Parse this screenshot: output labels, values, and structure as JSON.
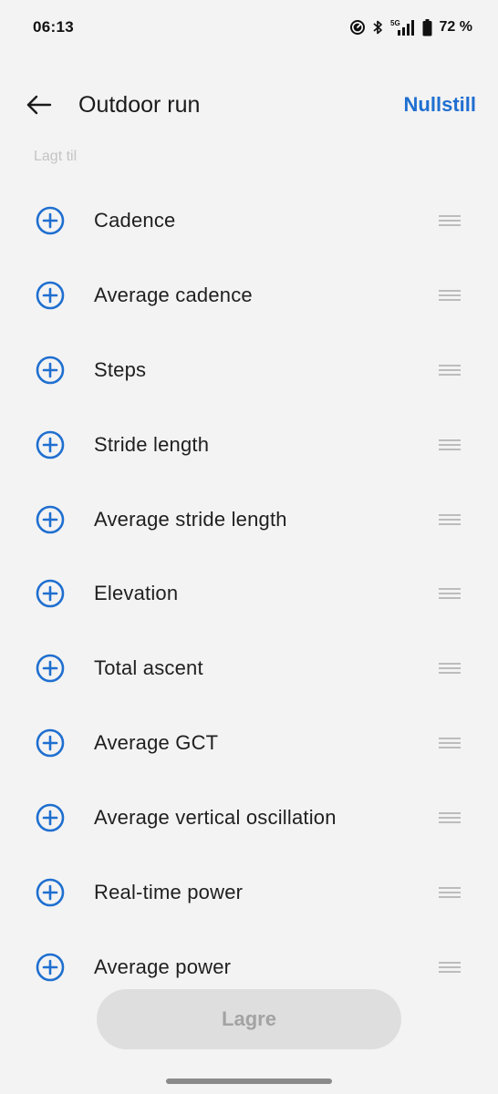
{
  "status_bar": {
    "time": "06:13",
    "network": "5G",
    "battery_text": "72 %",
    "icons": [
      "speedometer-icon",
      "bluetooth-icon",
      "signal-icon",
      "battery-icon"
    ]
  },
  "header": {
    "title": "Outdoor run",
    "back_icon": "arrow-left-icon",
    "reset_label": "Nullstill"
  },
  "section": {
    "label": "Lagt til"
  },
  "metrics": [
    {
      "label": "Cadence"
    },
    {
      "label": "Average cadence"
    },
    {
      "label": "Steps"
    },
    {
      "label": "Stride length"
    },
    {
      "label": "Average stride length"
    },
    {
      "label": "Elevation"
    },
    {
      "label": "Total ascent"
    },
    {
      "label": "Average GCT"
    },
    {
      "label": "Average vertical oscillation"
    },
    {
      "label": "Real-time power"
    },
    {
      "label": "Average power"
    }
  ],
  "save_label": "Lagre",
  "colors": {
    "accent": "#1f6fd0",
    "background": "#f3f3f3",
    "disabled_button": "#dedede",
    "disabled_text": "#a3a3a3"
  }
}
